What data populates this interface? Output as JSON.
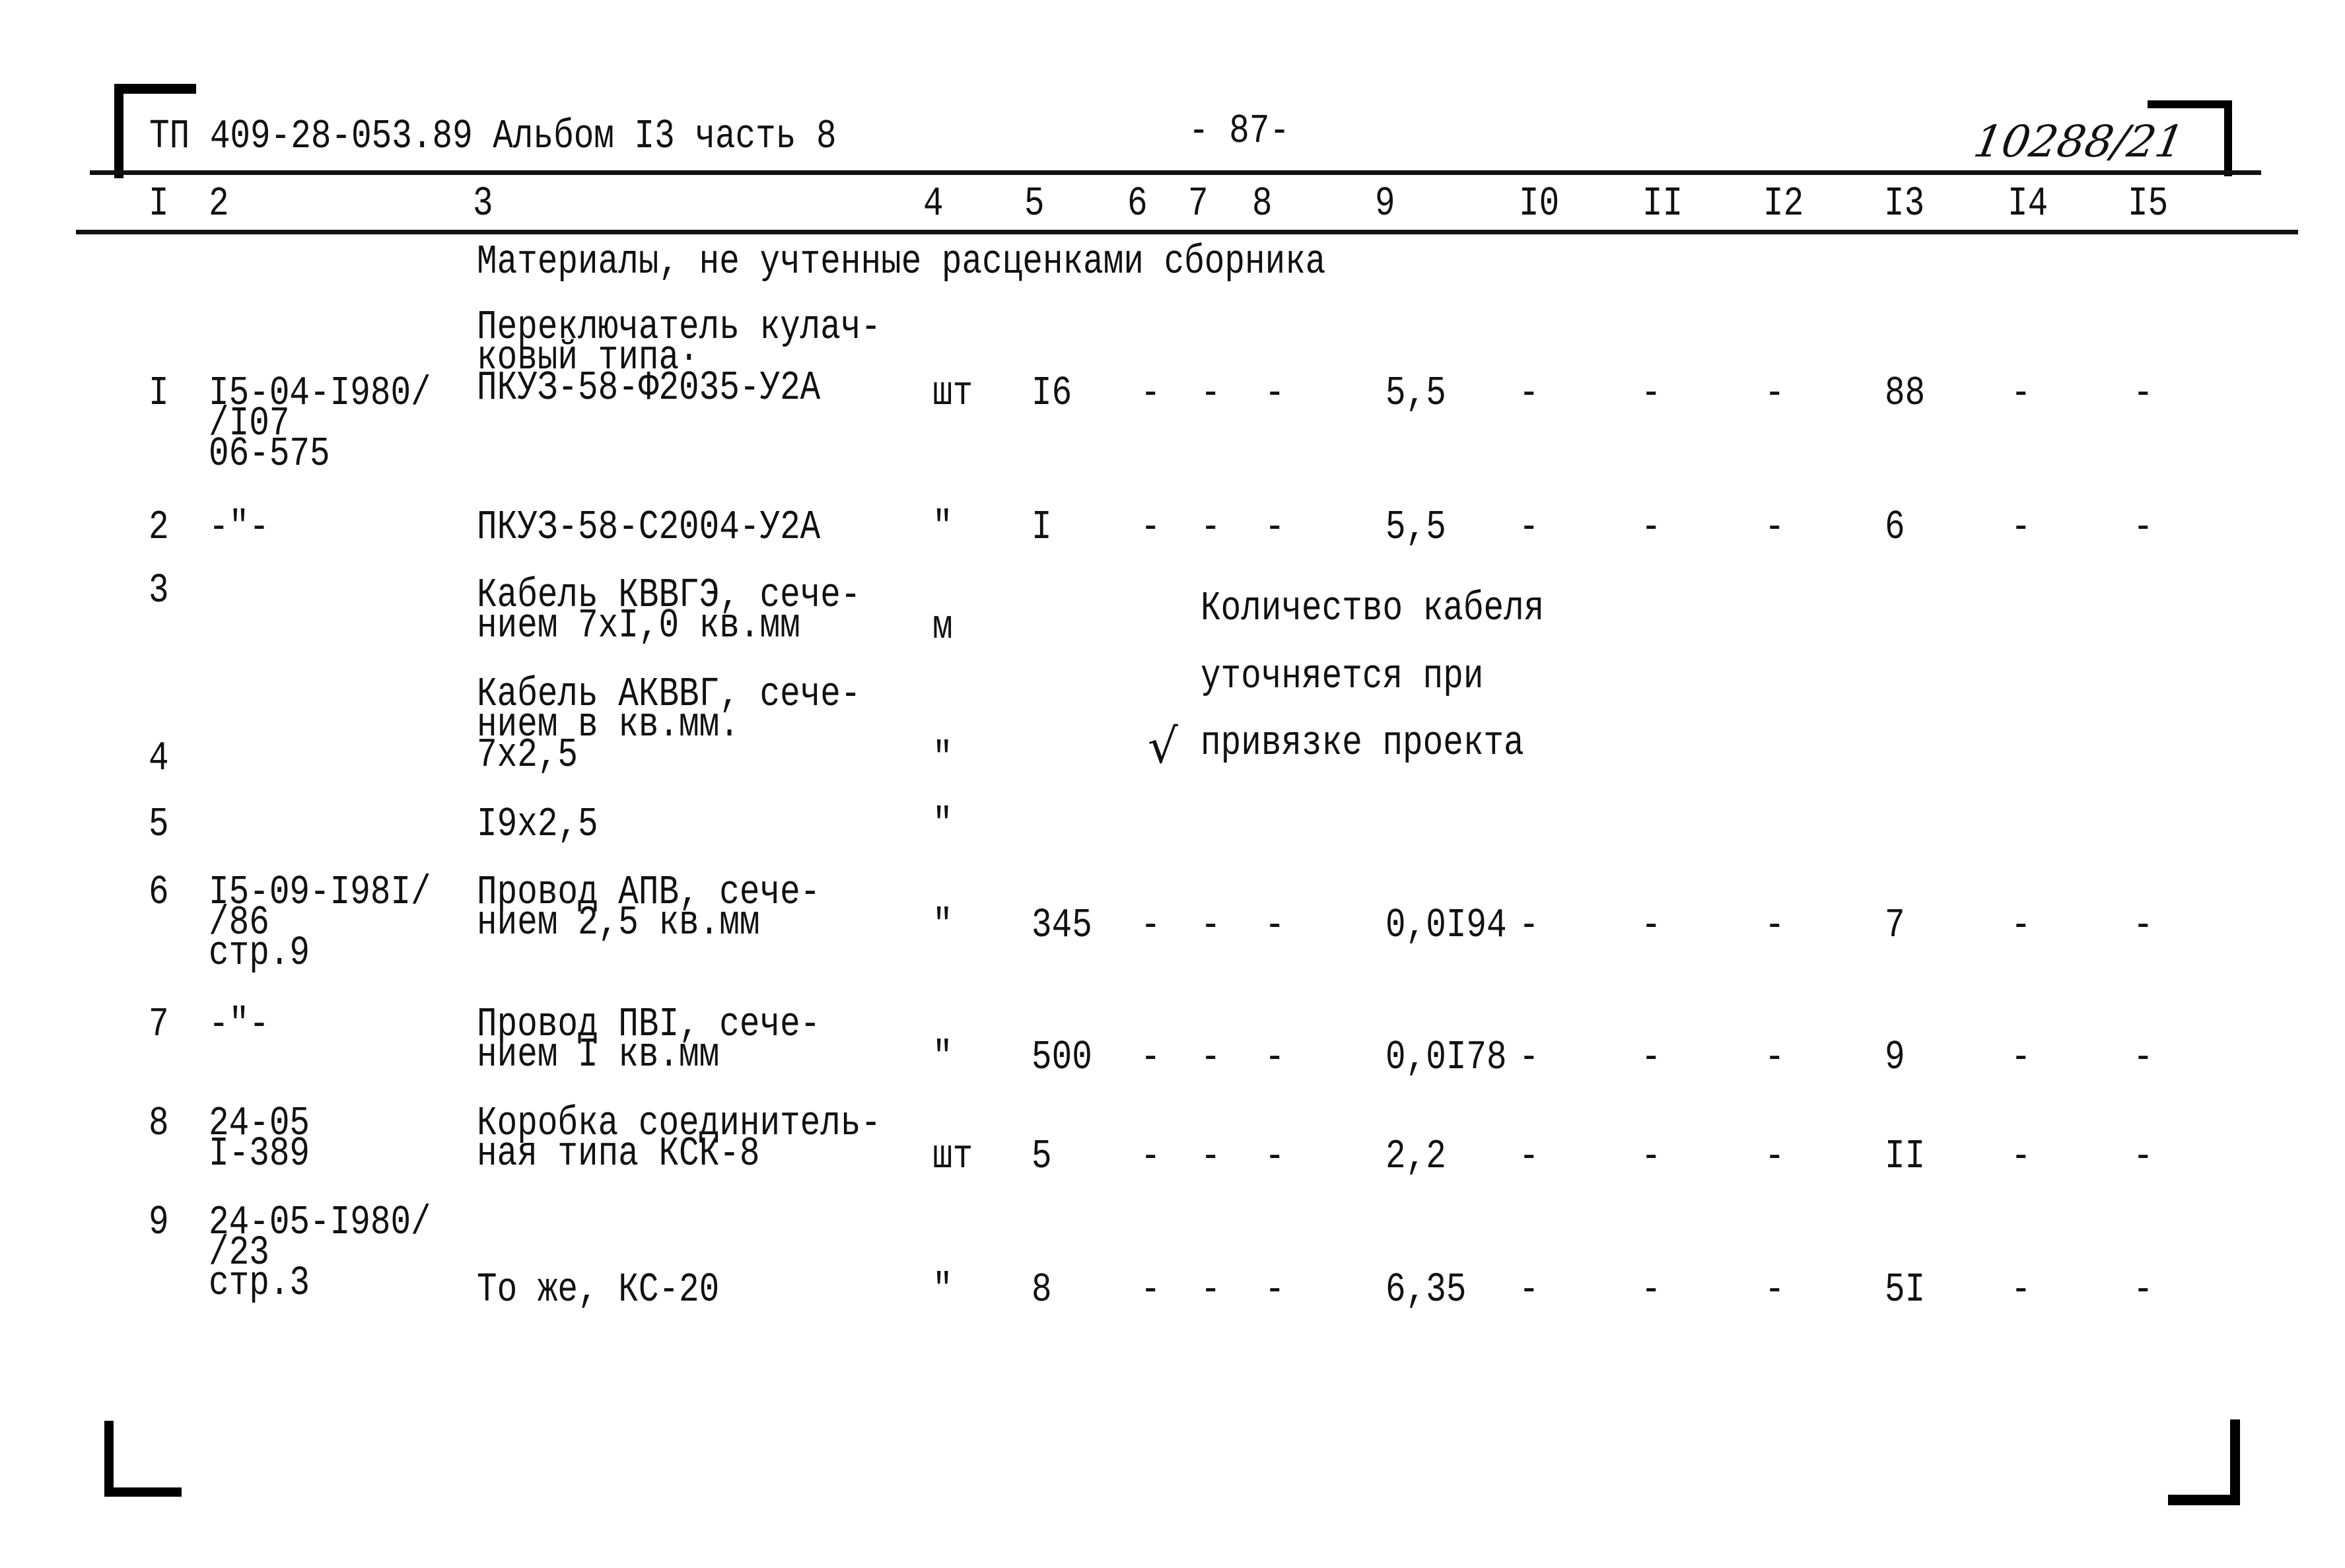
{
  "header": {
    "doc_code": "ТП 409-28-053.89 Альбом I3 часть 8",
    "page_number": "- 87-",
    "handwritten_ref": "10288/21"
  },
  "columns": [
    "I",
    "2",
    "3",
    "4",
    "5",
    "6",
    "7",
    "8",
    "9",
    "I0",
    "II",
    "I2",
    "I3",
    "I4",
    "I5"
  ],
  "section_title": "Материалы, не учтенные расценками сборника",
  "rows": [
    {
      "n": "I",
      "ref": [
        "I5-04-I980/",
        "/I07",
        "06-575"
      ],
      "name": [
        "Переключатель кулач-",
        "ковый типа·",
        "ПКУЗ-58-Ф2035-У2А"
      ],
      "unit": "шт",
      "qty": "I6",
      "c6": "-",
      "c7": "-",
      "c8": "-",
      "c9": "5,5",
      "c10": "-",
      "c11": "-",
      "c12": "-",
      "c13": "88",
      "c14": "-",
      "c15": "-"
    },
    {
      "n": "2",
      "ref": [
        "-\"-"
      ],
      "name": [
        "ПКУЗ-58-С2004-У2А"
      ],
      "unit": "\"",
      "qty": "I",
      "c6": "-",
      "c7": "-",
      "c8": "-",
      "c9": "5,5",
      "c10": "-",
      "c11": "-",
      "c12": "-",
      "c13": "6",
      "c14": "-",
      "c15": "-"
    },
    {
      "n": "3",
      "ref": [],
      "name": [
        "Кабель КВВГЭ, сече-",
        "нием 7хI,0 кв.мм"
      ],
      "unit": "м"
    },
    {
      "n": "4",
      "ref": [],
      "name": [
        "Кабель АКВВГ, сече-",
        "нием в кв.мм.",
        "7х2,5"
      ],
      "unit": "\""
    },
    {
      "n": "5",
      "ref": [],
      "name": [
        "I9х2,5"
      ],
      "unit": "\""
    },
    {
      "n": "6",
      "ref": [
        "I5-09-I98I/",
        "/86",
        "стр.9"
      ],
      "name": [
        "Провод АПВ, сече-",
        "нием 2,5 кв.мм"
      ],
      "unit": "\"",
      "qty": "345",
      "c6": "-",
      "c7": "-",
      "c8": "-",
      "c9": "0,0I94",
      "c10": "-",
      "c11": "-",
      "c12": "-",
      "c13": "7",
      "c14": "-",
      "c15": "-"
    },
    {
      "n": "7",
      "ref": [
        "-\"-"
      ],
      "name": [
        "Провод ПВI, сече-",
        "нием I кв.мм"
      ],
      "unit": "\"",
      "qty": "500",
      "c6": "-",
      "c7": "-",
      "c8": "-",
      "c9": "0,0I78",
      "c10": "-",
      "c11": "-",
      "c12": "-",
      "c13": "9",
      "c14": "-",
      "c15": "-"
    },
    {
      "n": "8",
      "ref": [
        "24-05",
        "I-389"
      ],
      "name": [
        "Коробка соединитель-",
        "ная типа КСК-8"
      ],
      "unit": "шт",
      "qty": "5",
      "c6": "-",
      "c7": "-",
      "c8": "-",
      "c9": "2,2",
      "c10": "-",
      "c11": "-",
      "c12": "-",
      "c13": "II",
      "c14": "-",
      "c15": "-"
    },
    {
      "n": "9",
      "ref": [
        "24-05-I980/",
        "/23",
        "стр.3"
      ],
      "name": [
        "То же, КС-20"
      ],
      "unit": "\"",
      "qty": "8",
      "c6": "-",
      "c7": "-",
      "c8": "-",
      "c9": "6,35",
      "c10": "-",
      "c11": "-",
      "c12": "-",
      "c13": "5I",
      "c14": "-",
      "c15": "-"
    }
  ],
  "cable_note": [
    "Количество кабеля",
    "уточняется при",
    "привязке проекта"
  ],
  "check_mark": "√"
}
